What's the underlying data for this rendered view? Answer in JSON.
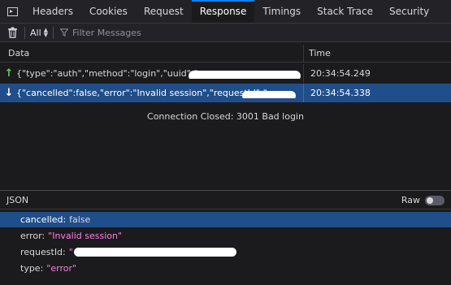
{
  "tabs": [
    "Headers",
    "Cookies",
    "Request",
    "Response",
    "Timings",
    "Stack Trace",
    "Security"
  ],
  "active_tab": "Response",
  "toolbar": {
    "filter_type": "All",
    "filter_placeholder": "Filter Messages"
  },
  "table": {
    "col_data": "Data",
    "col_time": "Time"
  },
  "messages": [
    {
      "direction": "sent",
      "icon": "arrow-up-icon",
      "text": "{\"type\":\"auth\",\"method\":\"login\",\"uuid\":\"",
      "time": "20:34:54.249"
    },
    {
      "direction": "received",
      "icon": "arrow-down-icon",
      "text": "{\"cancelled\":false,\"error\":\"Invalid session\",\"requestId\":\"",
      "time": "20:34:54.338"
    }
  ],
  "status": "Connection Closed: 3001 Bad login",
  "json_panel": {
    "title": "JSON",
    "raw_label": "Raw",
    "raw_enabled": false,
    "props": [
      {
        "key": "cancelled:",
        "value": "false",
        "kind": "bool"
      },
      {
        "key": "error:",
        "value": "\"Invalid session\"",
        "kind": "str"
      },
      {
        "key": "requestId:",
        "value": "\"",
        "kind": "str"
      },
      {
        "key": "type:",
        "value": "\"error\"",
        "kind": "str"
      }
    ]
  },
  "colors": {
    "accent": "#0a84ff",
    "selection": "#204e8a",
    "sent_arrow": "#5ad858",
    "string_value": "#ff7de9"
  }
}
